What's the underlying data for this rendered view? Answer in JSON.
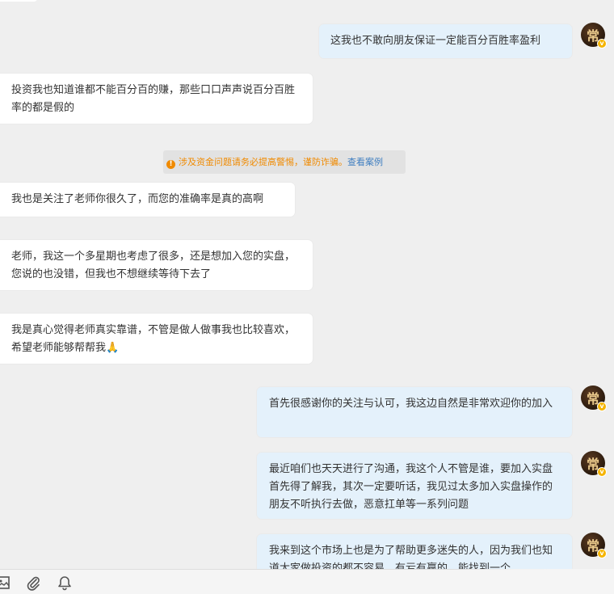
{
  "avatar_char": "常",
  "verified_mark": "v",
  "messages": [
    {
      "side": "out",
      "text": "这我也不敢向朋友保证一定能百分百胜率盈利"
    },
    {
      "side": "in",
      "text": "投资我也知道谁都不能百分百的赚，那些口口声声说百分百胜率的都是假的"
    },
    {
      "side": "in",
      "text": "我也是关注了老师你很久了，而您的准确率是真的高啊"
    },
    {
      "side": "in",
      "text": "老师，我这一个多星期也考虑了很多，还是想加入您的实盘，您说的也没错，但我也不想继续等待下去了"
    },
    {
      "side": "in",
      "text": "我是真心觉得老师真实靠谱，不管是做人做事我也比较喜欢，希望老师能够帮帮我🙏"
    },
    {
      "side": "out",
      "text": "首先很感谢你的关注与认可，我这边自然是非常欢迎你的加入"
    },
    {
      "side": "out",
      "text": "最近咱们也天天进行了沟通，我这个人不管是谁，要加入实盘首先得了解我，其次一定要听话，我见过太多加入实盘操作的朋友不听执行去做，恶意扛单等一系列问题"
    },
    {
      "side": "out",
      "text": "我来到这个市场上也是为了帮助更多迷失的人，因为我们也知道大家做投资的都不容易，有亏有赢的，能找到一个"
    }
  ],
  "notice": {
    "warning": "涉及资金问题请务必提高警惕，谨防诈骗。",
    "link": "查看案例"
  },
  "toolbar": {
    "icons": [
      "image-icon",
      "attachment-icon",
      "bell-icon"
    ]
  }
}
